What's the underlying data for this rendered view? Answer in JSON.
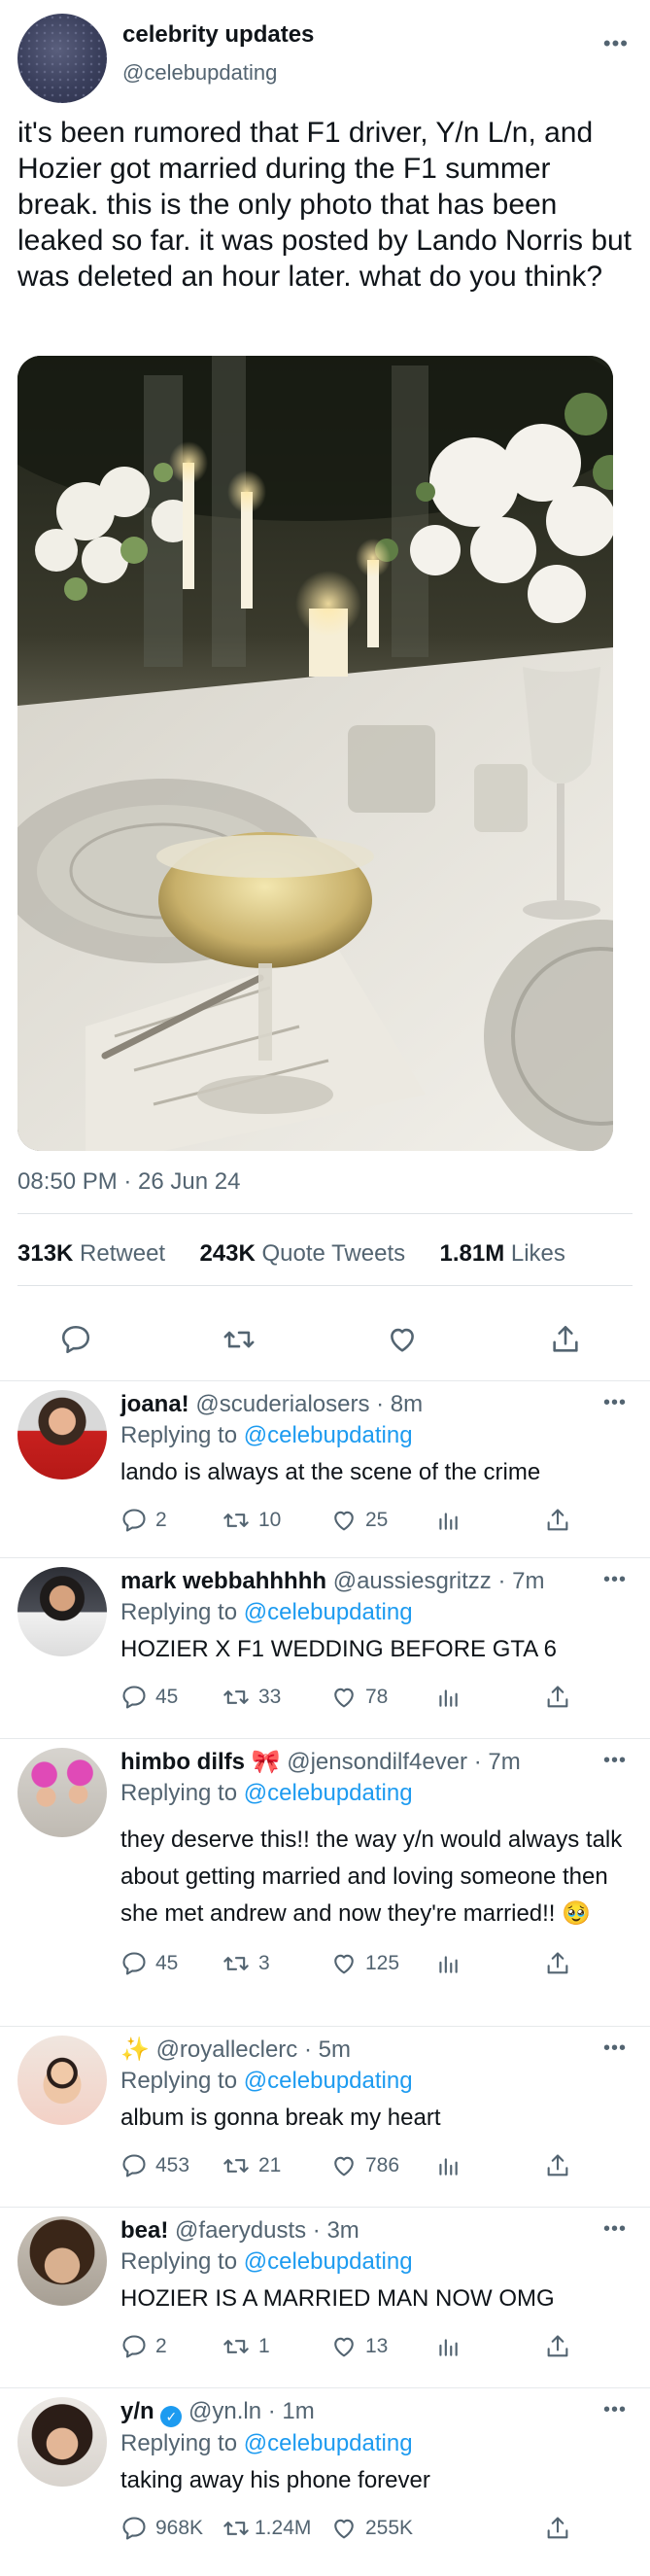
{
  "tweet": {
    "author_name": "celebrity updates",
    "author_handle": "@celebupdating",
    "text": "it's been rumored that F1 driver, Y/n L/n, and Hozier got married during the F1 summer break. this is the only photo that has been leaked so far. it was posted by Lando Norris but was deleted an hour later. what do you think?",
    "timestamp": "08:50 PM · 26 Jun 24",
    "retweets": "313K",
    "retweets_label": "Retweet",
    "quotes": "243K",
    "quotes_label": "Quote Tweets",
    "likes": "1.81M",
    "likes_label": "Likes",
    "more": "•••"
  },
  "icons": {
    "reply": "reply-icon",
    "retweet": "retweet-icon",
    "like": "heart-icon",
    "share": "share-icon",
    "analytics": "analytics-icon",
    "verified": "verified-badge-icon"
  },
  "colors": {
    "link": "#1d9bf0",
    "secondary_text": "#536471",
    "primary_text": "#0f1419"
  },
  "replies": [
    {
      "name": "joana!",
      "handle": "@scuderialosers · 8m",
      "replying_prefix": "Replying to",
      "replying_to": "@celebupdating",
      "text": "lando is always at the scene of the crime",
      "reply_count": "2",
      "retweet_count": "10",
      "like_count": "25",
      "more": "•••"
    },
    {
      "name": "mark webbahhhhh",
      "handle": "@aussiesgritzz · 7m",
      "replying_prefix": "Replying to",
      "replying_to": "@celebupdating",
      "text": "HOZIER X F1 WEDDING BEFORE GTA 6",
      "reply_count": "45",
      "retweet_count": "33",
      "like_count": "78",
      "more": "•••"
    },
    {
      "name": "himbo dilfs 🎀",
      "handle": "@jensondilf4ever · 7m",
      "replying_prefix": "Replying to",
      "replying_to": "@celebupdating",
      "text": "they deserve this!! the way y/n would always talk about getting married and loving someone then she met andrew and now they're married!! 🥹",
      "reply_count": "45",
      "retweet_count": "3",
      "like_count": "125",
      "more": "•••"
    },
    {
      "name": "✨",
      "handle": "@royalleclerc · 5m",
      "replying_prefix": "Replying to",
      "replying_to": "@celebupdating",
      "text": "album is gonna break my heart",
      "reply_count": "453",
      "retweet_count": "21",
      "like_count": "786",
      "more": "•••"
    },
    {
      "name": "bea!",
      "handle": "@faerydusts · 3m",
      "replying_prefix": "Replying to",
      "replying_to": "@celebupdating",
      "text": "HOZIER IS A MARRIED MAN NOW OMG",
      "reply_count": "2",
      "retweet_count": "1",
      "like_count": "13",
      "more": "•••"
    },
    {
      "name": "y/n",
      "handle": "@yn.ln · 1m",
      "replying_prefix": "Replying to",
      "replying_to": "@celebupdating",
      "text": "taking away his phone forever",
      "reply_count": "968K",
      "retweet_count": "1.24M",
      "like_count": "255K",
      "more": "•••"
    }
  ]
}
